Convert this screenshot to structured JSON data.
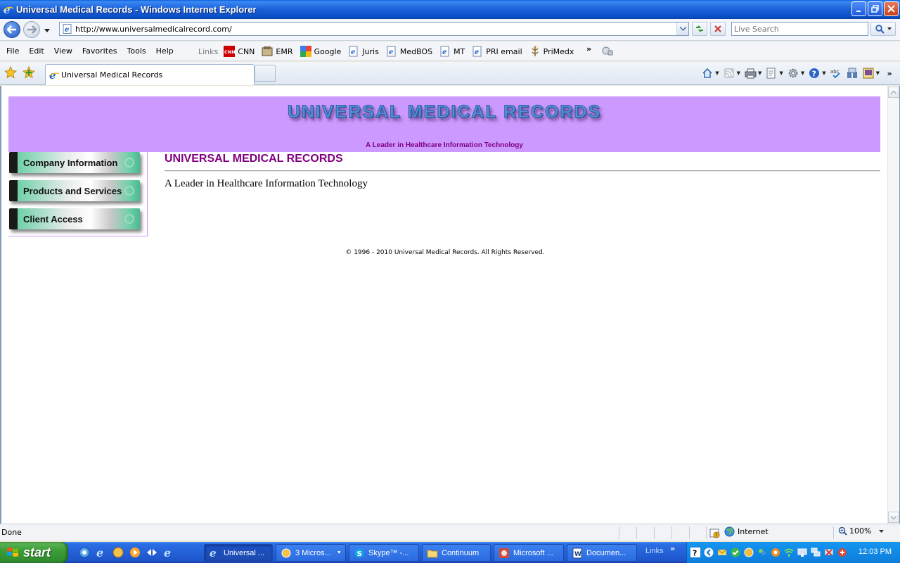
{
  "window": {
    "title": "Universal Medical Records - Windows Internet Explorer"
  },
  "address": {
    "url": "http://www.universalmedicalrecord.com/",
    "search_placeholder": "Live Search"
  },
  "menu": [
    "File",
    "Edit",
    "View",
    "Favorites",
    "Tools",
    "Help"
  ],
  "links": {
    "label": "Links",
    "items": [
      {
        "label": "CNN",
        "icon": "cnn-icon"
      },
      {
        "label": "EMR",
        "icon": "emr-icon"
      },
      {
        "label": "Google",
        "icon": "google-icon"
      },
      {
        "label": "Juris",
        "icon": "ie-page-icon"
      },
      {
        "label": "MedBOS",
        "icon": "ie-page-icon"
      },
      {
        "label": "MT",
        "icon": "ie-page-icon"
      },
      {
        "label": "PRI email",
        "icon": "ie-page-icon"
      },
      {
        "label": "PriMedx",
        "icon": "primedx-icon"
      }
    ]
  },
  "tab": {
    "title": "Universal Medical Records"
  },
  "page": {
    "banner_title": "UNIVERSAL MEDICAL RECORDS",
    "banner_tagline": "A Leader in Healthcare Information Technology",
    "nav": [
      "Company Information",
      "Products and Services",
      "Client Access"
    ],
    "heading": "UNIVERSAL MEDICAL RECORDS",
    "body": "A Leader in Healthcare Information Technology",
    "copyright": "© 1996 - 2010 Universal Medical Records.  All Rights Reserved."
  },
  "status": {
    "text": "Done",
    "zone": "Internet",
    "zoom": "100%"
  },
  "taskbar": {
    "start": "start",
    "tasks": [
      {
        "label": "Universal ...",
        "active": true
      },
      {
        "label": "3 Micros...",
        "active": false
      },
      {
        "label": "Skype™ -...",
        "active": false
      },
      {
        "label": "Continuum",
        "active": false
      },
      {
        "label": "Microsoft ...",
        "active": false
      },
      {
        "label": "Documen...",
        "active": false
      }
    ],
    "links_label": "Links",
    "clock": "12:03 PM"
  },
  "colors": {
    "banner_bg": "#cc99ff",
    "heading": "#800080",
    "xp_blue": "#2461d8",
    "start_green": "#3c9d38"
  }
}
